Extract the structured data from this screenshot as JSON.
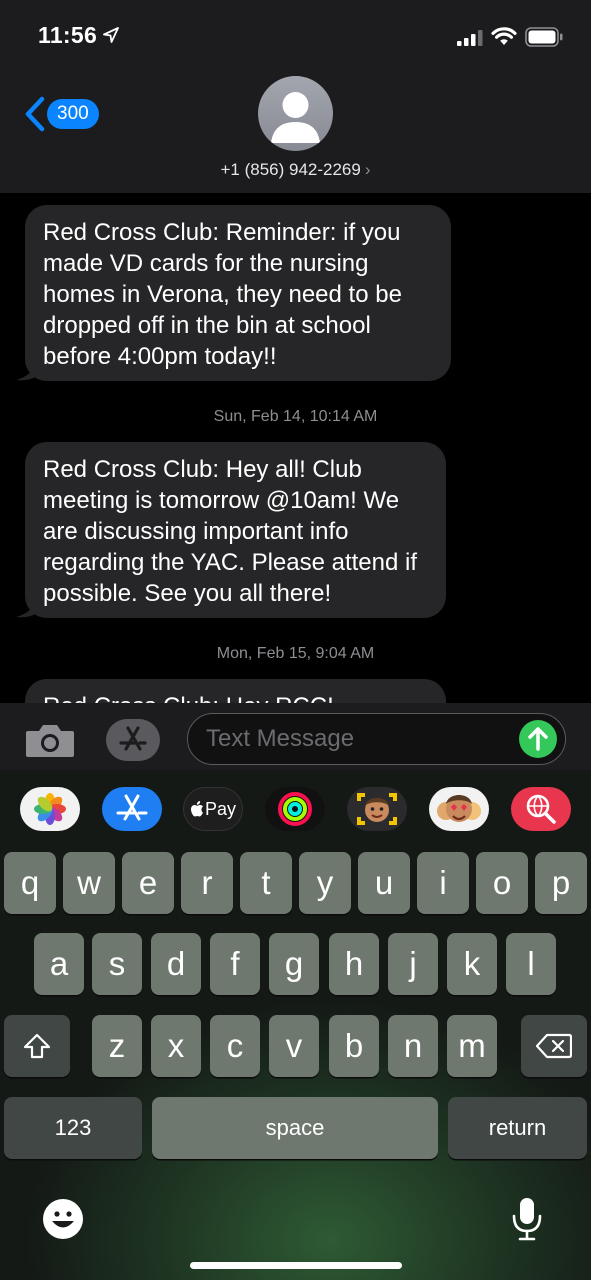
{
  "status_bar": {
    "time": "11:56"
  },
  "header": {
    "back_count": "300",
    "contact_number": "+1 (856) 942-2269",
    "contact_chevron": "›"
  },
  "thread": {
    "messages": [
      {
        "text": "Red Cross Club: Reminder: if you made VD cards for the nursing homes in Verona, they need to be dropped off in the bin at school before 4:00pm today!!"
      },
      {
        "timestamp": "Sun, Feb 14, 10:14 AM"
      },
      {
        "text": "Red Cross Club: Hey all! Club meeting is tomorrow @10am! We are discussing important info regarding the YAC. Please attend if possible. See you all there!"
      },
      {
        "timestamp": "Mon, Feb 15, 9:04 AM"
      },
      {
        "text": "Red Cross Club: Hey RCC!"
      }
    ]
  },
  "input": {
    "placeholder": "Text Message"
  },
  "app_strip": {
    "items": [
      {
        "name": "photos-app-icon"
      },
      {
        "name": "app-store-app-icon"
      },
      {
        "name": "apple-pay-app-icon",
        "label": "Pay"
      },
      {
        "name": "activity-app-icon"
      },
      {
        "name": "memoji-app-icon"
      },
      {
        "name": "memoji-stickers-app-icon"
      },
      {
        "name": "web-images-search-app-icon"
      }
    ]
  },
  "keyboard": {
    "row1": [
      "q",
      "w",
      "e",
      "r",
      "t",
      "y",
      "u",
      "i",
      "o",
      "p"
    ],
    "row2": [
      "a",
      "s",
      "d",
      "f",
      "g",
      "h",
      "j",
      "k",
      "l"
    ],
    "row3": [
      "z",
      "x",
      "c",
      "v",
      "b",
      "n",
      "m"
    ],
    "numbers_label": "123",
    "space_label": "space",
    "return_label": "return"
  },
  "colors": {
    "accent": "#0a84ff",
    "send": "#34c759",
    "bubble": "#262628"
  }
}
